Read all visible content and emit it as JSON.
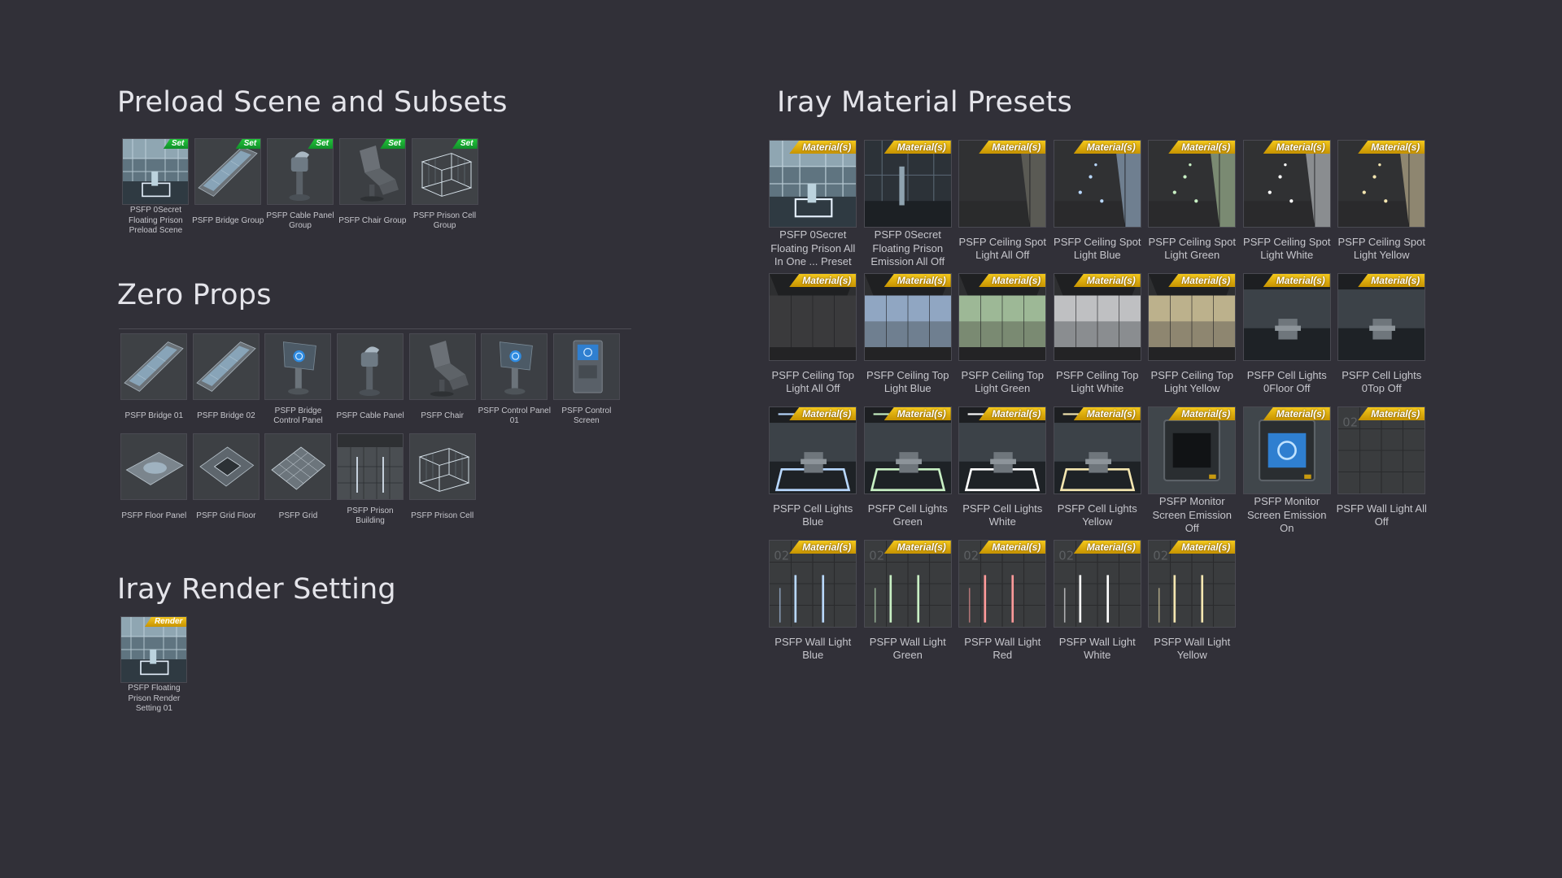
{
  "sections": {
    "preload": {
      "title": "Preload Scene and Subsets",
      "items": [
        {
          "label": "PSFP 0Secret Floating Prison Preload Scene",
          "tag": "Set",
          "icon": "prison-scene-thumbnail"
        },
        {
          "label": "PSFP Bridge Group",
          "tag": "Set",
          "icon": "bridge-thumbnail"
        },
        {
          "label": "PSFP Cable Panel Group",
          "tag": "Set",
          "icon": "cable-panel-thumbnail"
        },
        {
          "label": "PSFP Chair Group",
          "tag": "Set",
          "icon": "chair-thumbnail"
        },
        {
          "label": "PSFP Prison Cell Group",
          "tag": "Set",
          "icon": "prison-cell-thumbnail"
        }
      ]
    },
    "props": {
      "title": "Zero Props",
      "items": [
        {
          "label": "PSFP Bridge 01",
          "icon": "bridge-thumbnail"
        },
        {
          "label": "PSFP Bridge 02",
          "icon": "bridge-thumbnail"
        },
        {
          "label": "PSFP Bridge Control Panel",
          "icon": "control-panel-thumbnail"
        },
        {
          "label": "PSFP Cable Panel",
          "icon": "cable-panel-thumbnail"
        },
        {
          "label": "PSFP Chair",
          "icon": "chair-thumbnail"
        },
        {
          "label": "PSFP Control Panel 01",
          "icon": "control-panel-thumbnail"
        },
        {
          "label": "PSFP Control Screen",
          "icon": "control-screen-thumbnail"
        },
        {
          "label": "PSFP Floor Panel",
          "icon": "floor-panel-thumbnail"
        },
        {
          "label": "PSFP Grid Floor",
          "icon": "grid-floor-thumbnail"
        },
        {
          "label": "PSFP Grid",
          "icon": "grid-thumbnail"
        },
        {
          "label": "PSFP Prison Building",
          "icon": "prison-building-thumbnail"
        },
        {
          "label": "PSFP Prison Cell",
          "icon": "prison-cell-thumbnail"
        }
      ]
    },
    "render": {
      "title": "Iray Render Setting",
      "items": [
        {
          "label": "PSFP Floating Prison Render Setting 01",
          "tag": "Render",
          "icon": "prison-scene-thumbnail"
        }
      ]
    },
    "materials": {
      "title": "Iray Material Presets",
      "items": [
        {
          "label": "PSFP 0Secret Floating Prison All In One ... Preset",
          "tag": "Material(s)",
          "icon": "prison-scene-thumbnail"
        },
        {
          "label": "PSFP 0Secret Floating Prison Emission All Off",
          "tag": "Material(s)",
          "icon": "prison-dark-thumbnail"
        },
        {
          "label": "PSFP Ceiling Spot Light All Off",
          "tag": "Material(s)",
          "icon": "ceiling-spot-thumbnail"
        },
        {
          "label": "PSFP Ceiling Spot Light Blue",
          "tag": "Material(s)",
          "icon": "ceiling-spot-thumbnail"
        },
        {
          "label": "PSFP Ceiling Spot Light Green",
          "tag": "Material(s)",
          "icon": "ceiling-spot-thumbnail"
        },
        {
          "label": "PSFP Ceiling Spot Light White",
          "tag": "Material(s)",
          "icon": "ceiling-spot-thumbnail"
        },
        {
          "label": "PSFP Ceiling Spot Light Yellow",
          "tag": "Material(s)",
          "icon": "ceiling-spot-thumbnail"
        },
        {
          "label": "PSFP Ceiling Top Light All Off",
          "tag": "Material(s)",
          "icon": "ceiling-top-thumbnail"
        },
        {
          "label": "PSFP Ceiling Top Light Blue",
          "tag": "Material(s)",
          "icon": "ceiling-top-thumbnail"
        },
        {
          "label": "PSFP Ceiling Top Light Green",
          "tag": "Material(s)",
          "icon": "ceiling-top-thumbnail"
        },
        {
          "label": "PSFP Ceiling Top Light White",
          "tag": "Material(s)",
          "icon": "ceiling-top-thumbnail"
        },
        {
          "label": "PSFP Ceiling Top Light Yellow",
          "tag": "Material(s)",
          "icon": "ceiling-top-thumbnail"
        },
        {
          "label": "PSFP Cell Lights 0Floor Off",
          "tag": "Material(s)",
          "icon": "cell-lights-thumbnail"
        },
        {
          "label": "PSFP Cell Lights 0Top Off",
          "tag": "Material(s)",
          "icon": "cell-lights-thumbnail"
        },
        {
          "label": "PSFP Cell Lights Blue",
          "tag": "Material(s)",
          "icon": "cell-lights-thumbnail"
        },
        {
          "label": "PSFP Cell Lights Green",
          "tag": "Material(s)",
          "icon": "cell-lights-thumbnail"
        },
        {
          "label": "PSFP Cell Lights White",
          "tag": "Material(s)",
          "icon": "cell-lights-thumbnail"
        },
        {
          "label": "PSFP Cell Lights Yellow",
          "tag": "Material(s)",
          "icon": "cell-lights-thumbnail"
        },
        {
          "label": "PSFP Monitor Screen Emission Off",
          "tag": "Material(s)",
          "icon": "monitor-screen-thumbnail"
        },
        {
          "label": "PSFP Monitor Screen Emission On",
          "tag": "Material(s)",
          "icon": "monitor-screen-thumbnail"
        },
        {
          "label": "PSFP Wall Light All Off",
          "tag": "Material(s)",
          "icon": "wall-light-thumbnail"
        },
        {
          "label": "PSFP Wall Light Blue",
          "tag": "Material(s)",
          "icon": "wall-light-thumbnail"
        },
        {
          "label": "PSFP Wall Light Green",
          "tag": "Material(s)",
          "icon": "wall-light-thumbnail"
        },
        {
          "label": "PSFP Wall Light Red",
          "tag": "Material(s)",
          "icon": "wall-light-thumbnail"
        },
        {
          "label": "PSFP Wall Light White",
          "tag": "Material(s)",
          "icon": "wall-light-thumbnail"
        },
        {
          "label": "PSFP Wall Light Yellow",
          "tag": "Material(s)",
          "icon": "wall-light-thumbnail"
        }
      ]
    }
  },
  "colors": {
    "background": "#313038",
    "set_tag": "#1aa836",
    "material_tag": "#e6b30e",
    "title_text": "#e4e4ea",
    "label_text": "#c6c6cc"
  }
}
